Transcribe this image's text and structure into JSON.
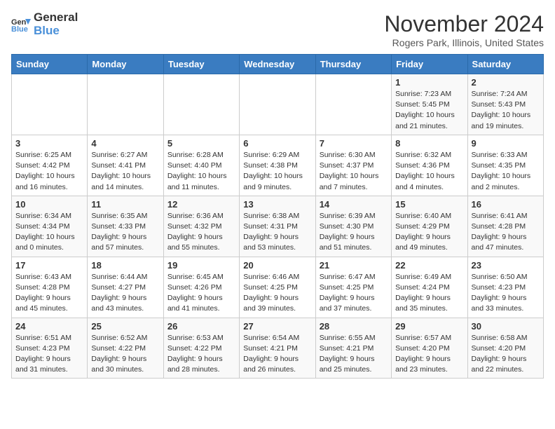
{
  "header": {
    "logo_line1": "General",
    "logo_line2": "Blue",
    "month_title": "November 2024",
    "location": "Rogers Park, Illinois, United States"
  },
  "weekdays": [
    "Sunday",
    "Monday",
    "Tuesday",
    "Wednesday",
    "Thursday",
    "Friday",
    "Saturday"
  ],
  "weeks": [
    [
      {
        "day": "",
        "info": ""
      },
      {
        "day": "",
        "info": ""
      },
      {
        "day": "",
        "info": ""
      },
      {
        "day": "",
        "info": ""
      },
      {
        "day": "",
        "info": ""
      },
      {
        "day": "1",
        "info": "Sunrise: 7:23 AM\nSunset: 5:45 PM\nDaylight: 10 hours and 21 minutes."
      },
      {
        "day": "2",
        "info": "Sunrise: 7:24 AM\nSunset: 5:43 PM\nDaylight: 10 hours and 19 minutes."
      }
    ],
    [
      {
        "day": "3",
        "info": "Sunrise: 6:25 AM\nSunset: 4:42 PM\nDaylight: 10 hours and 16 minutes."
      },
      {
        "day": "4",
        "info": "Sunrise: 6:27 AM\nSunset: 4:41 PM\nDaylight: 10 hours and 14 minutes."
      },
      {
        "day": "5",
        "info": "Sunrise: 6:28 AM\nSunset: 4:40 PM\nDaylight: 10 hours and 11 minutes."
      },
      {
        "day": "6",
        "info": "Sunrise: 6:29 AM\nSunset: 4:38 PM\nDaylight: 10 hours and 9 minutes."
      },
      {
        "day": "7",
        "info": "Sunrise: 6:30 AM\nSunset: 4:37 PM\nDaylight: 10 hours and 7 minutes."
      },
      {
        "day": "8",
        "info": "Sunrise: 6:32 AM\nSunset: 4:36 PM\nDaylight: 10 hours and 4 minutes."
      },
      {
        "day": "9",
        "info": "Sunrise: 6:33 AM\nSunset: 4:35 PM\nDaylight: 10 hours and 2 minutes."
      }
    ],
    [
      {
        "day": "10",
        "info": "Sunrise: 6:34 AM\nSunset: 4:34 PM\nDaylight: 10 hours and 0 minutes."
      },
      {
        "day": "11",
        "info": "Sunrise: 6:35 AM\nSunset: 4:33 PM\nDaylight: 9 hours and 57 minutes."
      },
      {
        "day": "12",
        "info": "Sunrise: 6:36 AM\nSunset: 4:32 PM\nDaylight: 9 hours and 55 minutes."
      },
      {
        "day": "13",
        "info": "Sunrise: 6:38 AM\nSunset: 4:31 PM\nDaylight: 9 hours and 53 minutes."
      },
      {
        "day": "14",
        "info": "Sunrise: 6:39 AM\nSunset: 4:30 PM\nDaylight: 9 hours and 51 minutes."
      },
      {
        "day": "15",
        "info": "Sunrise: 6:40 AM\nSunset: 4:29 PM\nDaylight: 9 hours and 49 minutes."
      },
      {
        "day": "16",
        "info": "Sunrise: 6:41 AM\nSunset: 4:28 PM\nDaylight: 9 hours and 47 minutes."
      }
    ],
    [
      {
        "day": "17",
        "info": "Sunrise: 6:43 AM\nSunset: 4:28 PM\nDaylight: 9 hours and 45 minutes."
      },
      {
        "day": "18",
        "info": "Sunrise: 6:44 AM\nSunset: 4:27 PM\nDaylight: 9 hours and 43 minutes."
      },
      {
        "day": "19",
        "info": "Sunrise: 6:45 AM\nSunset: 4:26 PM\nDaylight: 9 hours and 41 minutes."
      },
      {
        "day": "20",
        "info": "Sunrise: 6:46 AM\nSunset: 4:25 PM\nDaylight: 9 hours and 39 minutes."
      },
      {
        "day": "21",
        "info": "Sunrise: 6:47 AM\nSunset: 4:25 PM\nDaylight: 9 hours and 37 minutes."
      },
      {
        "day": "22",
        "info": "Sunrise: 6:49 AM\nSunset: 4:24 PM\nDaylight: 9 hours and 35 minutes."
      },
      {
        "day": "23",
        "info": "Sunrise: 6:50 AM\nSunset: 4:23 PM\nDaylight: 9 hours and 33 minutes."
      }
    ],
    [
      {
        "day": "24",
        "info": "Sunrise: 6:51 AM\nSunset: 4:23 PM\nDaylight: 9 hours and 31 minutes."
      },
      {
        "day": "25",
        "info": "Sunrise: 6:52 AM\nSunset: 4:22 PM\nDaylight: 9 hours and 30 minutes."
      },
      {
        "day": "26",
        "info": "Sunrise: 6:53 AM\nSunset: 4:22 PM\nDaylight: 9 hours and 28 minutes."
      },
      {
        "day": "27",
        "info": "Sunrise: 6:54 AM\nSunset: 4:21 PM\nDaylight: 9 hours and 26 minutes."
      },
      {
        "day": "28",
        "info": "Sunrise: 6:55 AM\nSunset: 4:21 PM\nDaylight: 9 hours and 25 minutes."
      },
      {
        "day": "29",
        "info": "Sunrise: 6:57 AM\nSunset: 4:20 PM\nDaylight: 9 hours and 23 minutes."
      },
      {
        "day": "30",
        "info": "Sunrise: 6:58 AM\nSunset: 4:20 PM\nDaylight: 9 hours and 22 minutes."
      }
    ]
  ]
}
